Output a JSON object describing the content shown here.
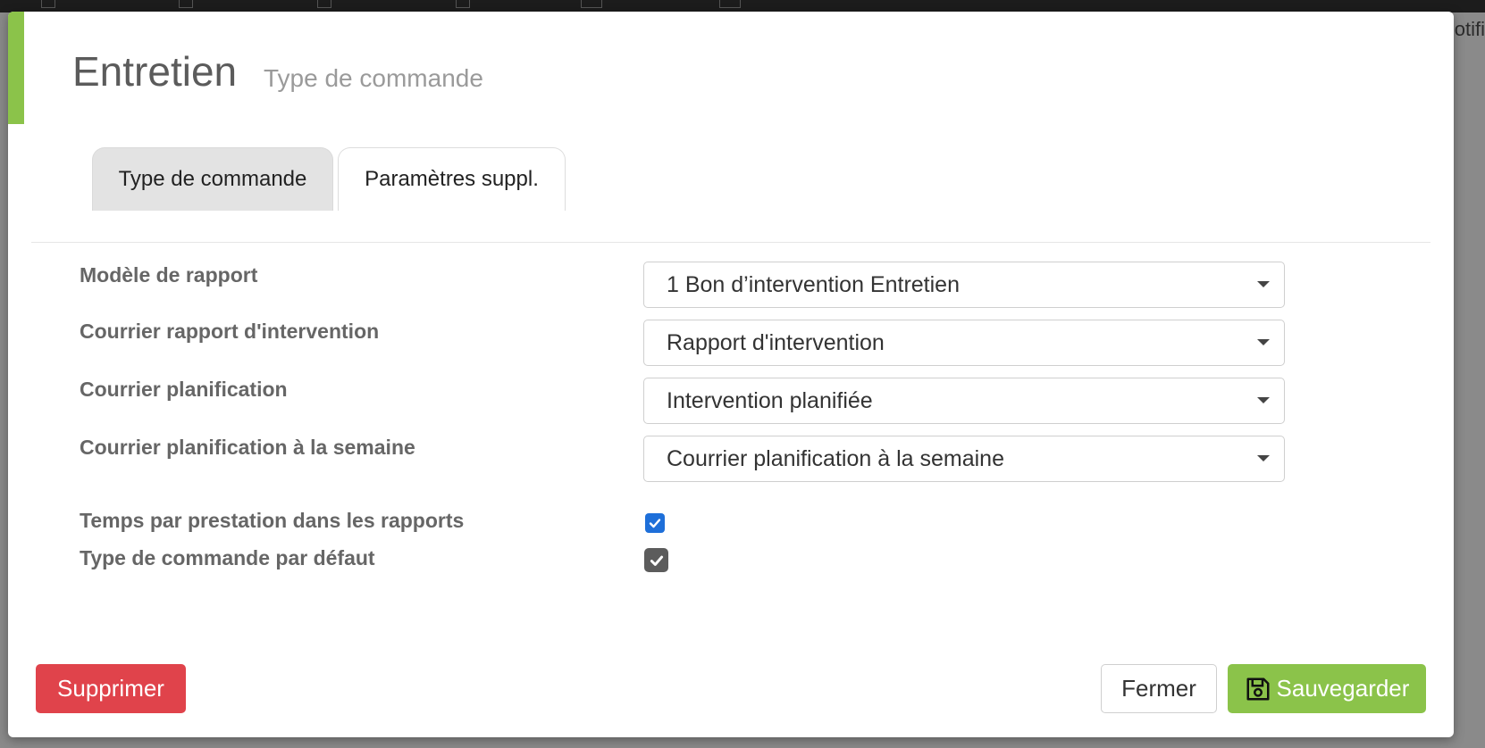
{
  "background": {
    "right_text": "otifi"
  },
  "modal": {
    "title": "Entretien",
    "subtitle": "Type de commande",
    "accent_color": "#8bc34a",
    "tabs": [
      {
        "label": "Type de commande",
        "active": false
      },
      {
        "label": "Paramètres suppl.",
        "active": true
      }
    ],
    "fields": [
      {
        "label": "Modèle de rapport",
        "value": "1 Bon d’intervention Entretien"
      },
      {
        "label": "Courrier rapport d'intervention",
        "value": "Rapport d'intervention"
      },
      {
        "label": "Courrier planification",
        "value": "Intervention planifiée"
      },
      {
        "label": "Courrier planification à la semaine",
        "value": "Courrier planification à la semaine"
      }
    ],
    "checkboxes": [
      {
        "label": "Temps par prestation dans les rapports",
        "checked": true,
        "color": "#1e6fd9"
      },
      {
        "label": "Type de commande par défaut",
        "checked": true,
        "color": "#5c5c5c"
      }
    ],
    "buttons": {
      "delete_label": "Supprimer",
      "delete_color": "#e0434b",
      "close_label": "Fermer",
      "save_label": "Sauvegarder",
      "save_color": "#8bc34a",
      "save_icon": "floppy-disk-icon"
    }
  }
}
